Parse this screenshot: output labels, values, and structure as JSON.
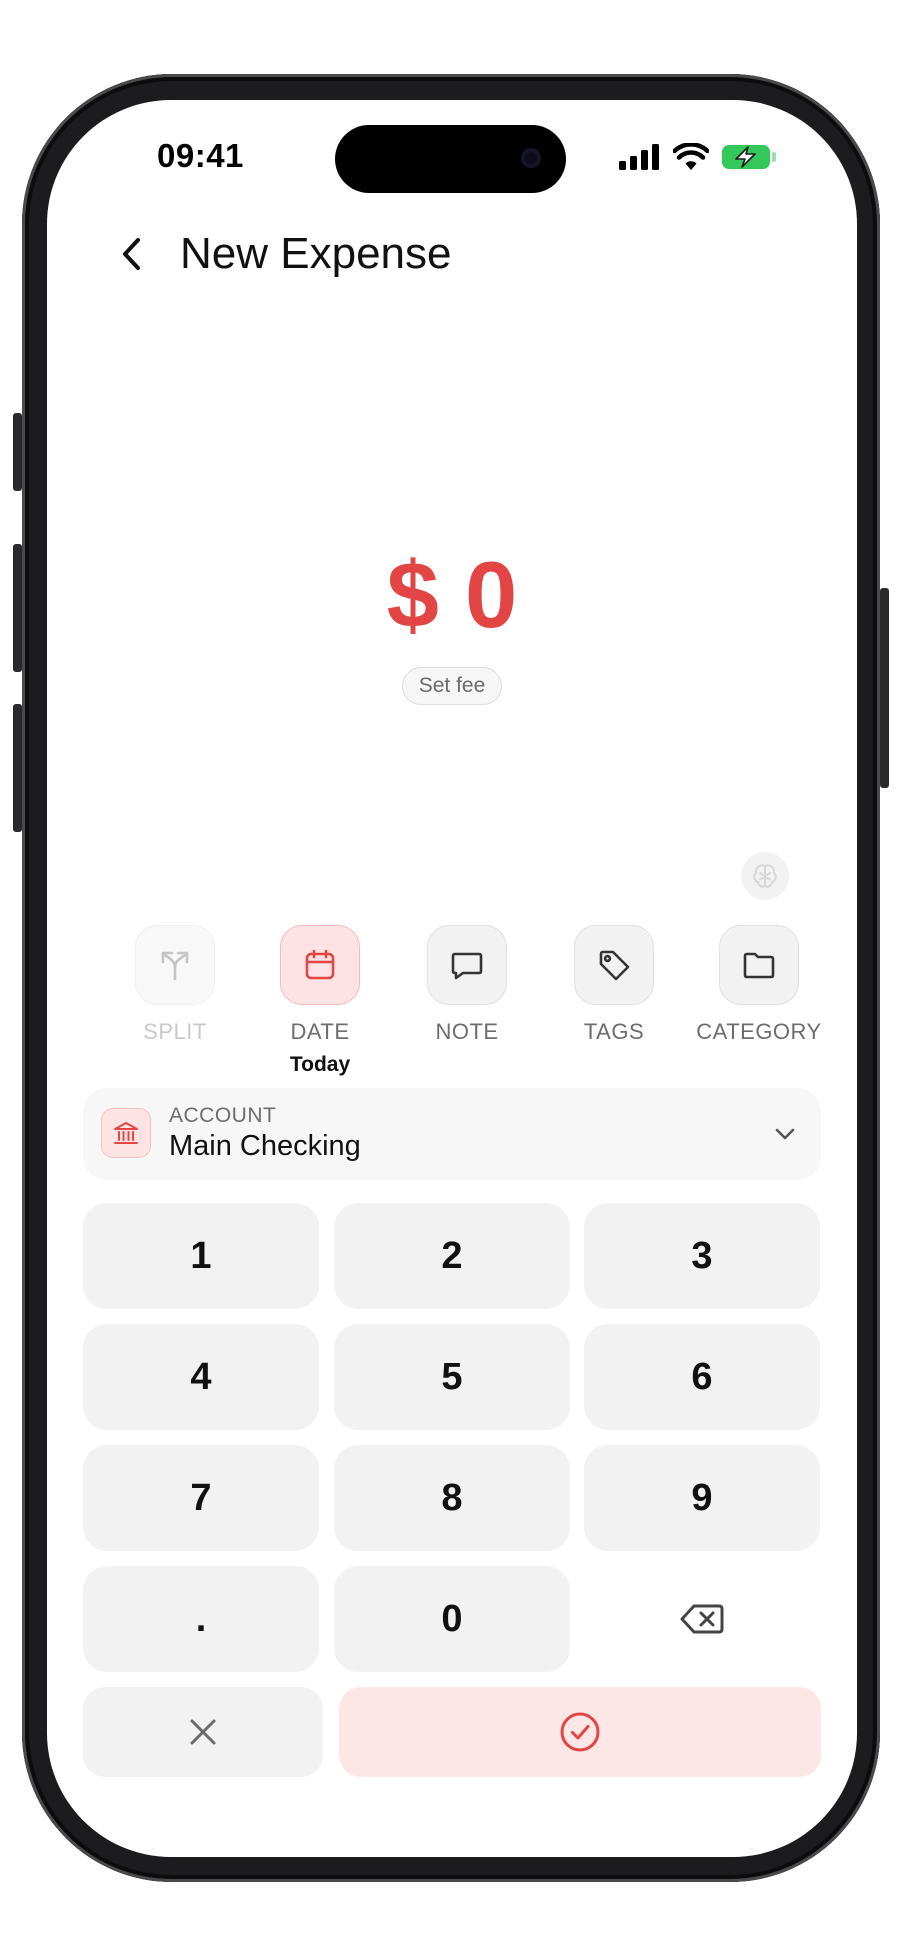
{
  "status": {
    "time": "09:41"
  },
  "header": {
    "title": "New Expense"
  },
  "amount": {
    "display": "$ 0",
    "fee_button": "Set fee"
  },
  "actions": [
    {
      "label": "SPLIT",
      "icon": "split-arrow-icon",
      "state": "disabled"
    },
    {
      "label": "DATE",
      "icon": "calendar-icon",
      "state": "active",
      "value": "Today"
    },
    {
      "label": "NOTE",
      "icon": "comment-icon",
      "state": "normal"
    },
    {
      "label": "TAGS",
      "icon": "tag-icon",
      "state": "normal"
    },
    {
      "label": "CATEGORY",
      "icon": "folder-icon",
      "state": "normal"
    }
  ],
  "account": {
    "caption": "ACCOUNT",
    "name": "Main Checking"
  },
  "keypad": {
    "keys": [
      "1",
      "2",
      "3",
      "4",
      "5",
      "6",
      "7",
      "8",
      "9",
      ".",
      "0"
    ],
    "backspace_icon": "backspace-icon",
    "cancel_icon": "close-icon",
    "confirm_icon": "check-circle-icon"
  },
  "colors": {
    "accent": "#e34545",
    "accent_soft": "#fde3e3",
    "key_bg": "#f2f2f2",
    "battery": "#34c759"
  }
}
